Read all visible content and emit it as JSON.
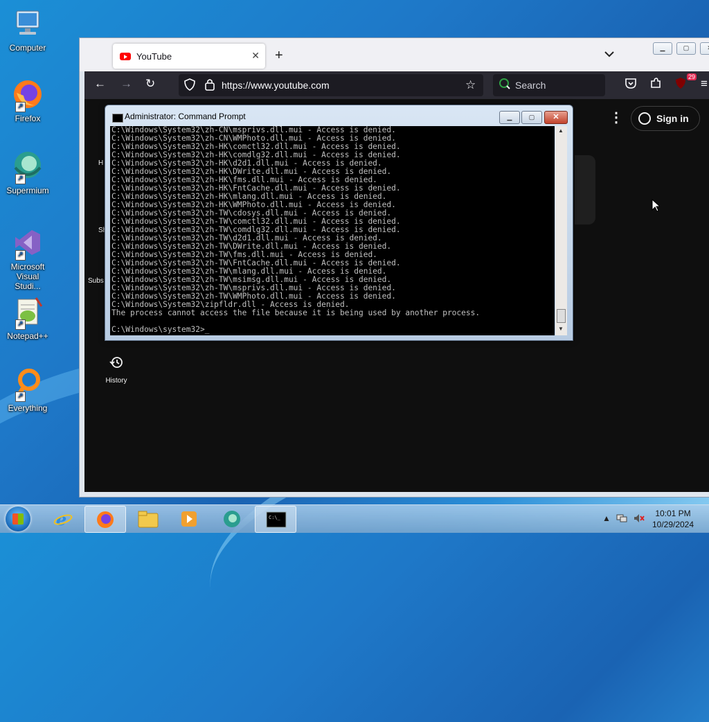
{
  "desktop": {
    "icons": [
      {
        "label": "Computer"
      },
      {
        "label": "Firefox"
      },
      {
        "label": "Supermium"
      },
      {
        "label": "Microsoft Visual Studi..."
      },
      {
        "label": "Notepad++"
      },
      {
        "label": "Everything"
      }
    ]
  },
  "browser": {
    "tab_title": "YouTube",
    "tab_close": "✕",
    "new_tab": "+",
    "url": "https://www.youtube.com",
    "search_label": "Search",
    "extension_badge": "29",
    "sign_in": "Sign in",
    "sidebar": {
      "history_label": "History",
      "peek_labels": [
        "H",
        "Sh",
        "Subs"
      ]
    }
  },
  "cmd": {
    "title": "Administrator: Command Prompt",
    "output": "C:\\Windows\\System32\\zh-CN\\msprivs.dll.mui - Access is denied.\nC:\\Windows\\System32\\zh-CN\\WMPhoto.dll.mui - Access is denied.\nC:\\Windows\\System32\\zh-HK\\comctl32.dll.mui - Access is denied.\nC:\\Windows\\System32\\zh-HK\\comdlg32.dll.mui - Access is denied.\nC:\\Windows\\System32\\zh-HK\\d2d1.dll.mui - Access is denied.\nC:\\Windows\\System32\\zh-HK\\DWrite.dll.mui - Access is denied.\nC:\\Windows\\System32\\zh-HK\\fms.dll.mui - Access is denied.\nC:\\Windows\\System32\\zh-HK\\FntCache.dll.mui - Access is denied.\nC:\\Windows\\System32\\zh-HK\\mlang.dll.mui - Access is denied.\nC:\\Windows\\System32\\zh-HK\\WMPhoto.dll.mui - Access is denied.\nC:\\Windows\\System32\\zh-TW\\cdosys.dll.mui - Access is denied.\nC:\\Windows\\System32\\zh-TW\\comctl32.dll.mui - Access is denied.\nC:\\Windows\\System32\\zh-TW\\comdlg32.dll.mui - Access is denied.\nC:\\Windows\\System32\\zh-TW\\d2d1.dll.mui - Access is denied.\nC:\\Windows\\System32\\zh-TW\\DWrite.dll.mui - Access is denied.\nC:\\Windows\\System32\\zh-TW\\fms.dll.mui - Access is denied.\nC:\\Windows\\System32\\zh-TW\\FntCache.dll.mui - Access is denied.\nC:\\Windows\\System32\\zh-TW\\mlang.dll.mui - Access is denied.\nC:\\Windows\\System32\\zh-TW\\msimsg.dll.mui - Access is denied.\nC:\\Windows\\System32\\zh-TW\\msprivs.dll.mui - Access is denied.\nC:\\Windows\\System32\\zh-TW\\WMPhoto.dll.mui - Access is denied.\nC:\\Windows\\System32\\zipfldr.dll - Access is denied.\nThe process cannot access the file because it is being used by another process.\n\nC:\\Windows\\system32>_"
  },
  "taskbar": {
    "time": "10:01 PM",
    "date": "10/29/2024"
  },
  "colors": {
    "desktop_blue": "#1e78c8",
    "youtube_red": "#ff0000",
    "firefox_toolbar": "#2b2a33",
    "youtube_bg": "#0f0f0f",
    "console_bg": "#000000",
    "console_text": "#c0c0c0"
  }
}
